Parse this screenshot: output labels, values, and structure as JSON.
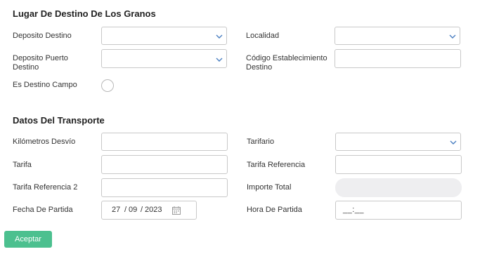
{
  "section_destino": {
    "title": "Lugar De Destino De Los Granos",
    "deposito_destino_label": "Deposito Destino",
    "localidad_label": "Localidad",
    "deposito_puerto_destino_label_1": "Deposito Puerto",
    "deposito_puerto_destino_label_2": "Destino",
    "codigo_establecimiento_label_1": "Código Establecimiento",
    "codigo_establecimiento_label_2": "Destino",
    "es_destino_campo_label": "Es Destino Campo"
  },
  "section_transporte": {
    "title": "Datos Del Transporte",
    "kilometros_desvio_label": "Kilómetros Desvío",
    "tarifario_label": "Tarifario",
    "tarifa_label": "Tarifa",
    "tarifa_referencia_label": "Tarifa Referencia",
    "tarifa_referencia_2_label": "Tarifa Referencia 2",
    "importe_total_label": "Importe Total",
    "fecha_partida_label": "Fecha De Partida",
    "fecha_partida_day": "27",
    "fecha_partida_month": "09",
    "fecha_partida_year": "2023",
    "date_separator": "/",
    "hora_partida_label": "Hora De Partida",
    "hora_partida_value": "__:__"
  },
  "actions": {
    "accept_label": "Aceptar"
  },
  "colors": {
    "accent": "#4cc08f",
    "chevron": "#4a7fc1"
  }
}
